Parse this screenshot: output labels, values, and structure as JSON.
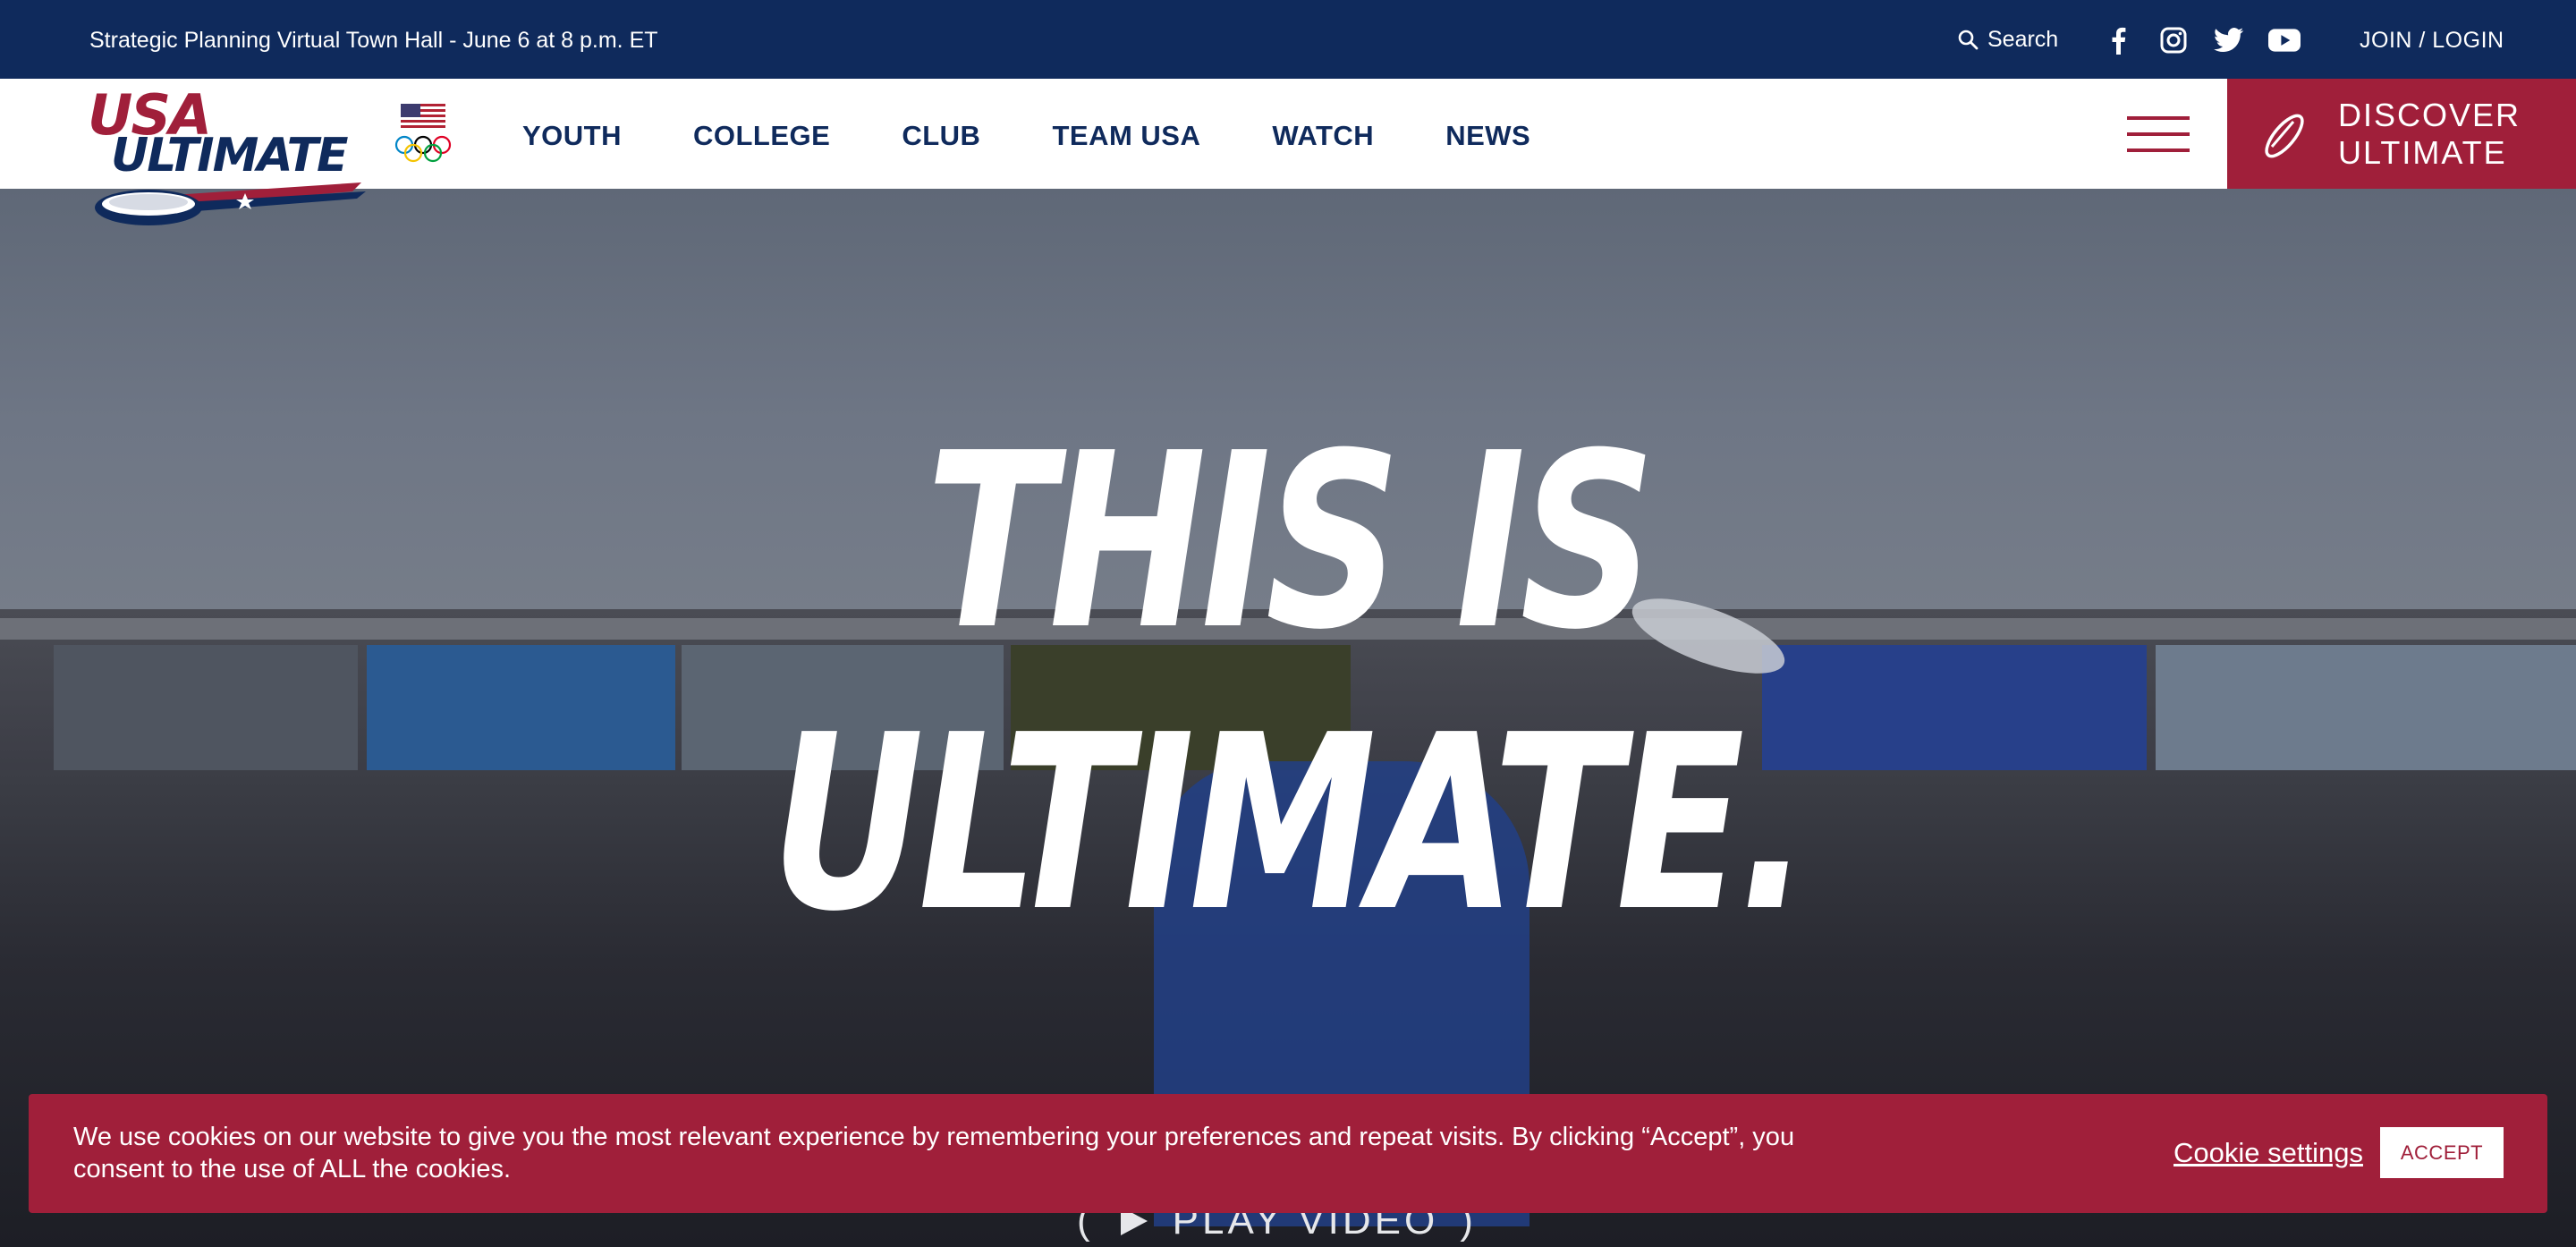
{
  "topbar": {
    "announcement": "Strategic Planning Virtual Town Hall - June 6 at 8 p.m. ET",
    "search_label": "Search",
    "social_icons": [
      "facebook-icon",
      "instagram-icon",
      "twitter-icon",
      "youtube-icon"
    ],
    "join_label": "JOIN / LOGIN"
  },
  "brand": {
    "logo_line1": "USA",
    "logo_line2": "ULTIMATE",
    "colors": {
      "navy": "#0f2a5c",
      "red": "#a01f3a",
      "white": "#ffffff"
    }
  },
  "nav": {
    "items": [
      {
        "label": "YOUTH"
      },
      {
        "label": "COLLEGE"
      },
      {
        "label": "CLUB"
      },
      {
        "label": "TEAM USA"
      },
      {
        "label": "WATCH"
      },
      {
        "label": "NEWS"
      }
    ],
    "discover_line1": "DISCOVER",
    "discover_line2": "ULTIMATE"
  },
  "hero": {
    "headline_line1": "THIS IS",
    "headline_line2": "ULTIMATE.",
    "play_label": "PLAY VIDEO"
  },
  "cookie": {
    "message": "We use cookies on our website to give you the most relevant experience by remembering your preferences and repeat visits. By clicking “Accept”, you consent to the use of ALL the cookies.",
    "settings_label": "Cookie settings",
    "accept_label": "ACCEPT"
  }
}
